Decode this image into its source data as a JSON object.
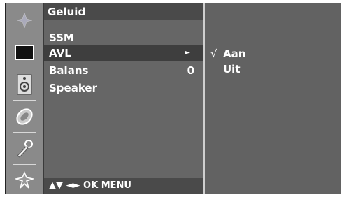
{
  "menu": {
    "title": "Geluid",
    "items": [
      {
        "label": "SSM",
        "value": "",
        "arrow": ""
      },
      {
        "label": "AVL",
        "value": "",
        "arrow": "►"
      },
      {
        "label": "Balans",
        "value": "0",
        "arrow": ""
      },
      {
        "label": "Speaker",
        "value": "",
        "arrow": ""
      }
    ],
    "selected_index": 1
  },
  "help": {
    "keys": "▲▼ ◄► OK MENU"
  },
  "submenu": {
    "options": [
      {
        "check": "√",
        "label": "Aan"
      },
      {
        "check": "",
        "label": "Uit"
      }
    ]
  },
  "icons": [
    "sound-icon",
    "picture-icon",
    "speaker-icon",
    "time-icon",
    "key-option-icon",
    "setup-icon"
  ]
}
